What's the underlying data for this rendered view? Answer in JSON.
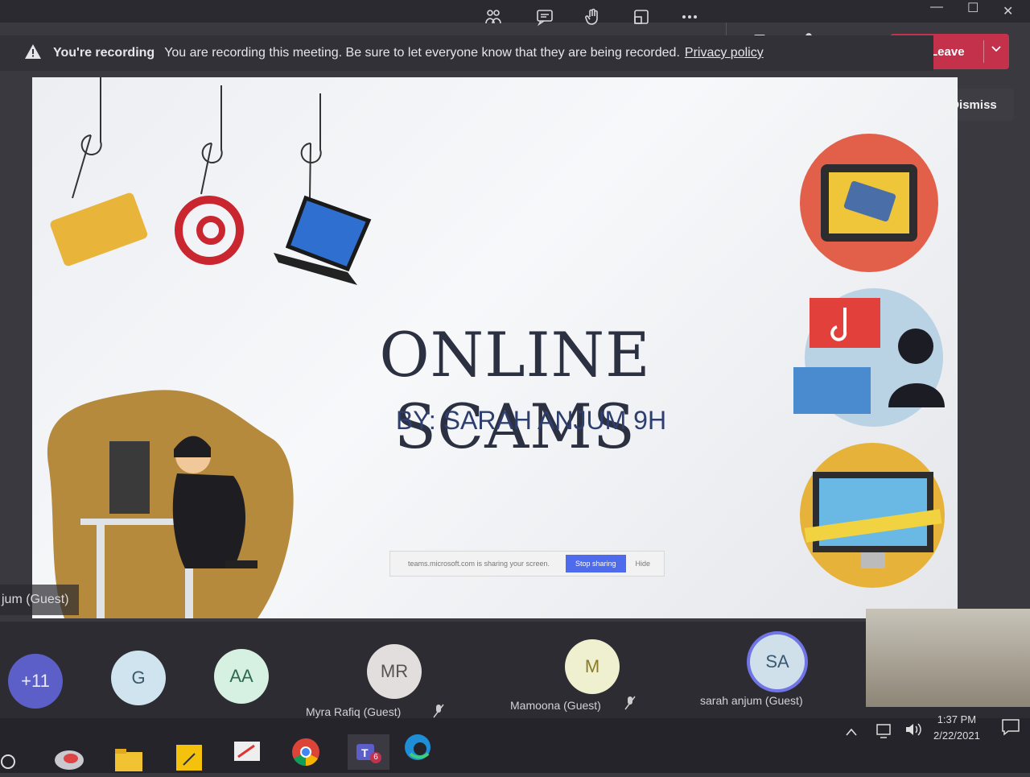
{
  "window": {
    "minimize": "—",
    "maximize": "☐",
    "close": "✕"
  },
  "toolbar": {
    "leave_label": "Leave",
    "icons": [
      "people-icon",
      "chat-icon",
      "reactions-icon",
      "rooms-icon",
      "more-icon",
      "camera-icon",
      "mic-icon",
      "share-icon"
    ]
  },
  "banner": {
    "title": "You're recording",
    "message": "You are recording this meeting. Be sure to let everyone know that they are being recorded.",
    "link": "Privacy policy",
    "dismiss_label": "Dismiss"
  },
  "slide": {
    "title": "ONLINE SCAMS",
    "subtitle": "BY: SARAH ANJUM 9H",
    "share_message": "teams.microsoft.com is sharing your screen.",
    "stop_sharing_label": "Stop sharing",
    "hide_label": "Hide"
  },
  "presenter_name": "jum (Guest)",
  "participants": [
    {
      "initials": "+11",
      "name": "",
      "color": "#5b5fc7"
    },
    {
      "initials": "G",
      "name": "",
      "color": "#cfe4ee"
    },
    {
      "initials": "AA",
      "name": "",
      "color": "#d6f0e2"
    },
    {
      "initials": "MR",
      "name": "Myra Rafiq (Guest)",
      "color": "#e2dedd"
    },
    {
      "initials": "M",
      "name": "Mamoona (Guest)",
      "color": "#eef0cf"
    },
    {
      "initials": "SA",
      "name": "sarah anjum (Guest)",
      "color": "#cfe0ea"
    }
  ],
  "taskbar": {
    "time": "1:37 PM",
    "date": "2/22/2021",
    "teams_badge": "6"
  }
}
